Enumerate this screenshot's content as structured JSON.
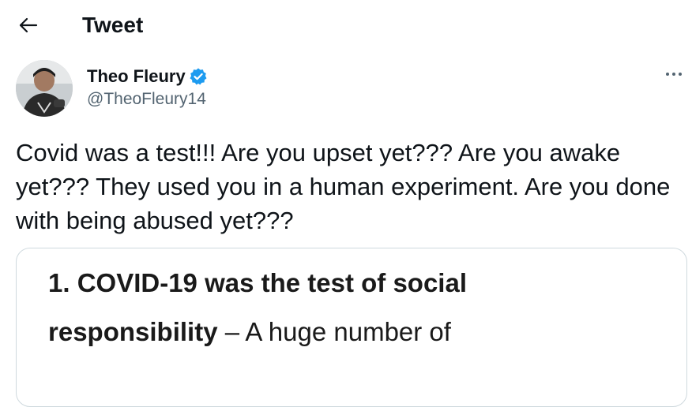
{
  "header": {
    "back_icon": "arrow-left-icon",
    "title": "Tweet"
  },
  "tweet": {
    "author": {
      "display_name": "Theo Fleury",
      "handle": "@TheoFleury14",
      "verified": true,
      "verified_color": "#1d9bf0"
    },
    "more_icon": "more-dots-icon",
    "text": "Covid was a test!!! Are you upset yet??? Are you awake yet??? They used you in a human experiment. Are you done with being abused yet???",
    "media": {
      "line1": "1. COVID-19 was the test of social",
      "line2_bold": "responsibility",
      "line2_rest": " – A huge number of"
    }
  },
  "colors": {
    "text_primary": "#0f1419",
    "text_secondary": "#536471",
    "border": "#cfd9de"
  }
}
